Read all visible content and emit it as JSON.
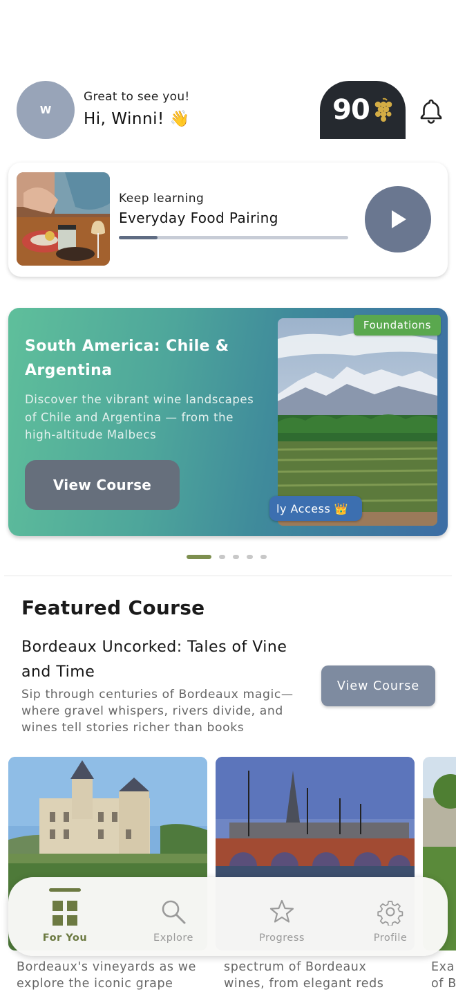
{
  "header": {
    "avatar_initial": "W",
    "greeting_small": "Great to see you!",
    "greeting_big": "Hi, Winni! 👋",
    "score": "90",
    "score_icon": "grapes-icon"
  },
  "keep_learning": {
    "label": "Keep learning",
    "title": "Everyday Food Pairing",
    "progress_fraction": 0.17
  },
  "hero": {
    "title": "South America: Chile & Argentina",
    "description": "Discover the vibrant wine landscapes of Chile and Argentina — from the high-altitude Malbecs",
    "button_label": "View Course",
    "badge": "Foundations",
    "access_label": "ly Access 👑",
    "carousel_count": 5,
    "carousel_active": 0
  },
  "featured": {
    "heading": "Featured Course",
    "title": "Bordeaux Uncorked: Tales of Vine and Time",
    "description": "Sip through centuries of Bordeaux magic—where gravel whispers, rivers divide, and wines tell stories richer than books",
    "button_label": "View Course",
    "cards": [
      {
        "desc_line1": "Bordeaux's vineyards as we",
        "desc_line2": "explore the iconic grape"
      },
      {
        "desc_line1": "spectrum of Bordeaux",
        "desc_line2": "wines, from elegant reds"
      },
      {
        "desc_line1": "Exa",
        "desc_line2": "of B"
      }
    ]
  },
  "nav": {
    "items": [
      {
        "label": "For You",
        "icon": "grid-icon",
        "active": true
      },
      {
        "label": "Explore",
        "icon": "search-icon",
        "active": false
      },
      {
        "label": "Progress",
        "icon": "star-icon",
        "active": false
      },
      {
        "label": "Profile",
        "icon": "gear-icon",
        "active": false
      }
    ]
  },
  "colors": {
    "accent_green": "#6c7a42",
    "hero_gradient_start": "#5fbf9b",
    "hero_gradient_end": "#3d6da4",
    "button_slate": "#7e8ba0"
  }
}
